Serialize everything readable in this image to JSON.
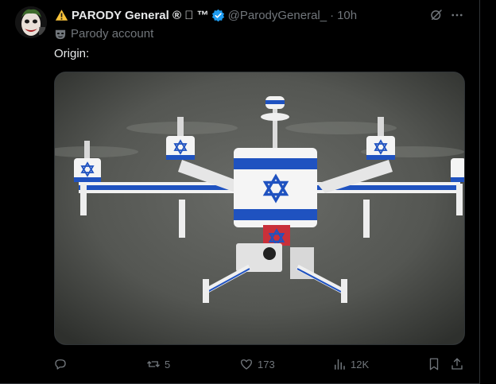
{
  "post": {
    "display_name": "PARODY General ®  ™",
    "handle": "@ParodyGeneral_",
    "separator": "·",
    "time": "10h",
    "label": "Parody account",
    "text": "Origin:"
  },
  "icons": {
    "warning": "warning-icon",
    "verified": "verified-badge-icon",
    "grok": "grok-icon",
    "more": "more-options-icon",
    "mask": "parody-mask-icon",
    "reply": "reply-icon",
    "repost": "repost-icon",
    "like": "like-icon",
    "views": "views-icon",
    "bookmark": "bookmark-icon",
    "share": "share-icon"
  },
  "colors": {
    "background": "#000000",
    "primary_text": "#e7e9ea",
    "secondary_text": "#71767b",
    "verified_blue": "#1d9bf0",
    "divider": "#2f3336",
    "flag_blue": "#1f52c0"
  },
  "actions": {
    "replies": "",
    "reposts": "5",
    "likes": "173",
    "views": "12K"
  }
}
